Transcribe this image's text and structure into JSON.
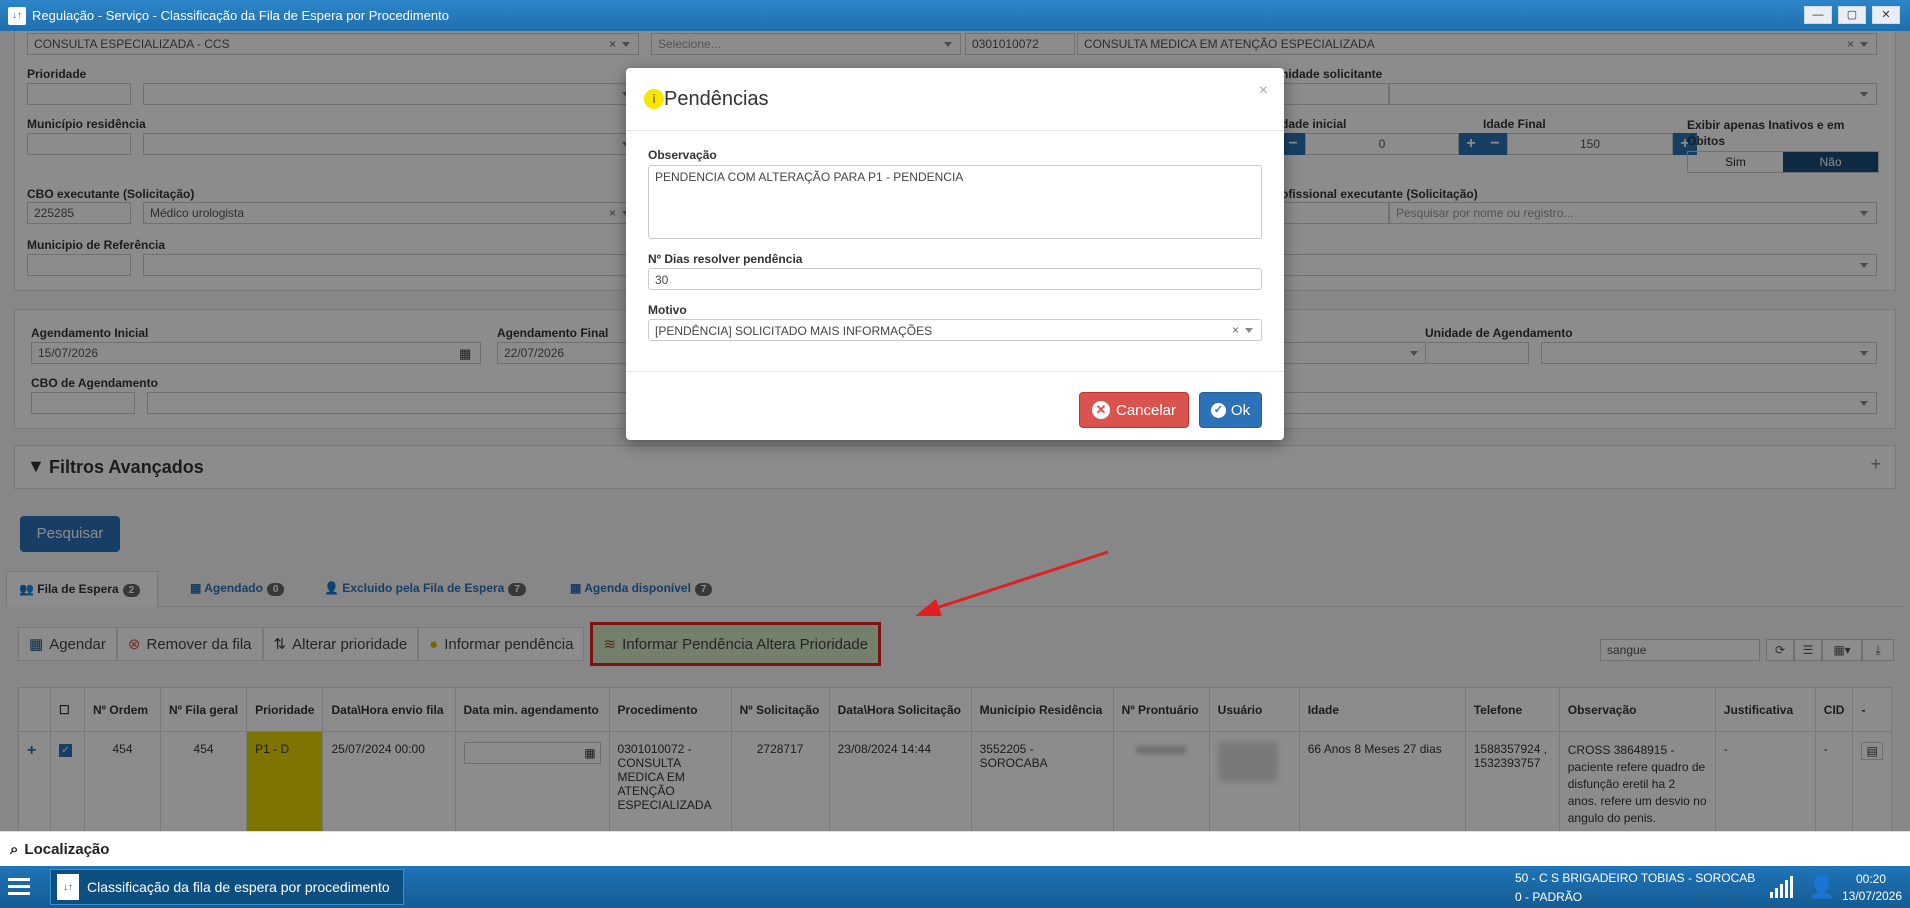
{
  "window": {
    "title": "Regulação - Serviço - Classificação da Fila de Espera por Procedimento"
  },
  "filters": {
    "row1": {
      "service_value": "CONSULTA ESPECIALIZADA - CCS",
      "select_placeholder": "Selecione...",
      "procedure_code": "0301010072",
      "procedure_name": "CONSULTA MEDICA EM ATENÇÃO ESPECIALIZADA"
    },
    "prioridade_label": "Prioridade",
    "unidade_solicitante_label": "nidade solicitante",
    "municipio_residencia_label": "Município residência",
    "idade_inicial_label": "dade inicial",
    "idade_inicial_value": "0",
    "idade_final_label": "Idade Final",
    "idade_final_value": "150",
    "inativos_label": "Exibir apenas Inativos e em Óbitos",
    "toggle_sim": "Sim",
    "toggle_nao": "Não",
    "cbo_label": "CBO executante (Solicitação)",
    "cbo_code": "225285",
    "cbo_name": "Médico urologista",
    "profissional_label": "ofissional executante (Solicitação)",
    "profissional_placeholder": "Pesquisar por nome ou registro...",
    "municipio_referencia_label": "Municipio de Referência",
    "agendamento_inicial_label": "Agendamento Inicial",
    "agendamento_inicial_value": "15/07/2026",
    "agendamento_final_label": "Agendamento Final",
    "agendamento_final_value": "22/07/2026",
    "unidade_agendamento_label": "Unidade de Agendamento",
    "cbo_agendamento_label": "CBO de Agendamento",
    "filtros_avancados": "Filtros Avançados",
    "pesquisar": "Pesquisar"
  },
  "tabs": [
    {
      "label": "Fila de Espera",
      "count": "2"
    },
    {
      "label": "Agendado",
      "count": "0"
    },
    {
      "label": "Excluido pela Fila de Espera",
      "count": "7"
    },
    {
      "label": "Agenda disponível",
      "count": "7"
    }
  ],
  "toolbar": {
    "agendar": "Agendar",
    "remover": "Remover da fila",
    "alterar": "Alterar prioridade",
    "informar": "Informar pendência",
    "informar_altera": "Informar Pendência Altera Prioridade",
    "search_value": "sangue"
  },
  "table": {
    "headers": [
      "Nº Ordem",
      "Nº Fila geral",
      "Prioridade",
      "Data\\Hora envio fila",
      "Data min. agendamento",
      "Procedimento",
      "Nº Solicitação",
      "Data\\Hora Solicitação",
      "Município Residência",
      "Nº Prontuário",
      "Usuário",
      "Idade",
      "Telefone",
      "Observação",
      "Justificativa",
      "CID",
      "-"
    ],
    "row": {
      "ordem": "454",
      "fila_geral": "454",
      "prioridade": "P1 - D",
      "envio": "25/07/2024 00:00",
      "procedimento": "0301010072 - CONSULTA MEDICA EM ATENÇÃO ESPECIALIZADA",
      "solicitacao": "2728717",
      "data_solicitacao": "23/08/2024 14:44",
      "municipio": "3552205 - SOROCABA",
      "idade": "66 Anos 8 Meses 27 dias",
      "telefone": "1588357924 , 1532393757",
      "observacao": "CROSS 38648915 - paciente refere quadro de disfunção eretil ha 2 anos. refere um desvio no angulo do penis.",
      "justificativa": "-",
      "cid": "-"
    }
  },
  "modal": {
    "title": "Pendências",
    "observacao_label": "Observação",
    "observacao_value": "PENDENCIA COM ALTERAÇÃO PARA P1 - PENDENCIA",
    "dias_label": "Nº Dias resolver pendência",
    "dias_value": "30",
    "motivo_label": "Motivo",
    "motivo_value": "[PENDÊNCIA] SOLICITADO MAIS INFORMAÇÕES",
    "cancelar": "Cancelar",
    "ok": "Ok"
  },
  "locbar": {
    "label": "Localização"
  },
  "taskbar": {
    "task_label": "Classificação da fila de espera por procedimento",
    "unit_line1": "50 - C S BRIGADEIRO TOBIAS - SOROCAB",
    "unit_line2": "0 - PADRÃO",
    "time": "00:20",
    "date": "13/07/2026"
  },
  "colors": {
    "accent": "#2d72b8",
    "danger": "#d9534f",
    "priority": "#e6d400",
    "highlight_border": "#e02020"
  }
}
